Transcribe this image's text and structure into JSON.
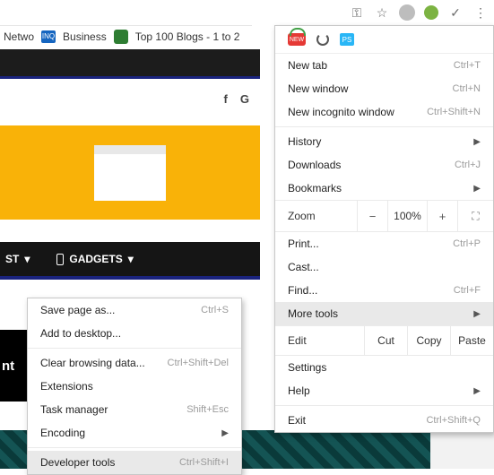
{
  "toolbar": {
    "icons": [
      "key-icon",
      "star-icon",
      "globe-icon",
      "leaf-icon",
      "check-icon",
      "kebab-menu-icon"
    ]
  },
  "bookmarks": {
    "items": [
      {
        "label": "Netwo"
      },
      {
        "label": "Business"
      },
      {
        "label": "Top 100 Blogs - 1 to 2"
      }
    ]
  },
  "nav": {
    "item1": "ST",
    "item2": "GADGETS"
  },
  "social": {
    "f": "f",
    "g": "G"
  },
  "tile_text": "nt",
  "menu": {
    "ext_new": "NEW",
    "ext_ps": "PS",
    "new_tab": "New tab",
    "new_tab_key": "Ctrl+T",
    "new_window": "New window",
    "new_window_key": "Ctrl+N",
    "incognito": "New incognito window",
    "incognito_key": "Ctrl+Shift+N",
    "history": "History",
    "downloads": "Downloads",
    "downloads_key": "Ctrl+J",
    "bookmarks": "Bookmarks",
    "zoom_label": "Zoom",
    "zoom_minus": "−",
    "zoom_value": "100%",
    "zoom_plus": "+",
    "print": "Print...",
    "print_key": "Ctrl+P",
    "cast": "Cast...",
    "find": "Find...",
    "find_key": "Ctrl+F",
    "more_tools": "More tools",
    "edit": "Edit",
    "cut": "Cut",
    "copy": "Copy",
    "paste": "Paste",
    "settings": "Settings",
    "help": "Help",
    "exit": "Exit",
    "exit_key": "Ctrl+Shift+Q"
  },
  "submenu": {
    "save_page": "Save page as...",
    "save_page_key": "Ctrl+S",
    "add_desktop": "Add to desktop...",
    "clear_data": "Clear browsing data...",
    "clear_data_key": "Ctrl+Shift+Del",
    "extensions": "Extensions",
    "task_manager": "Task manager",
    "task_manager_key": "Shift+Esc",
    "encoding": "Encoding",
    "dev_tools": "Developer tools",
    "dev_tools_key": "Ctrl+Shift+I"
  }
}
